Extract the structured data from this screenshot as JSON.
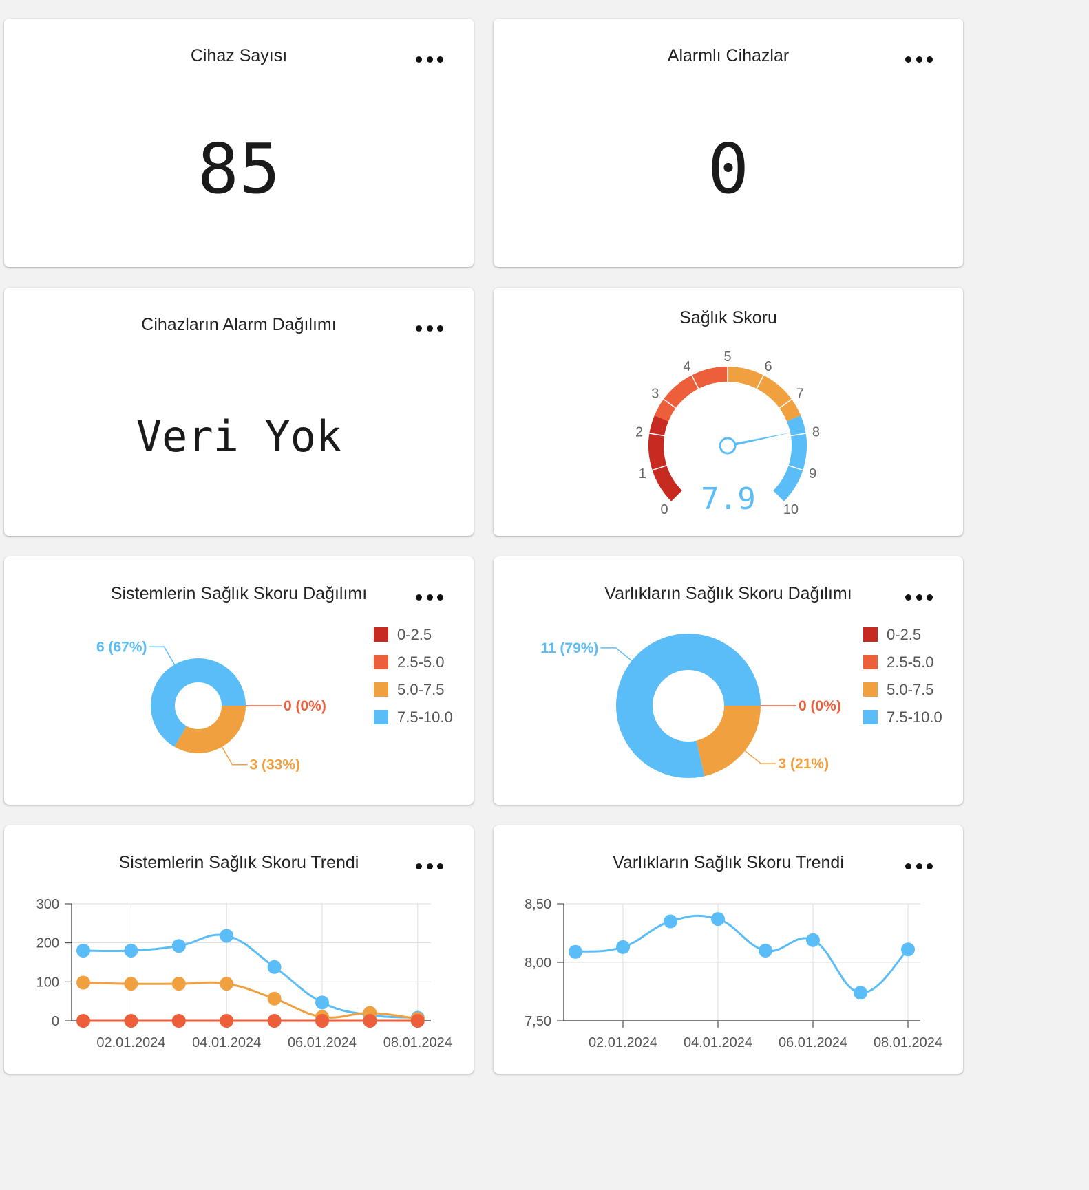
{
  "cards": {
    "device_count": {
      "title": "Cihaz Sayısı",
      "value": "85"
    },
    "alarmed_devices": {
      "title": "Alarmlı Cihazlar",
      "value": "0"
    },
    "alarm_distribution": {
      "title": "Cihazların Alarm Dağılımı",
      "value": "Veri Yok"
    },
    "health_score": {
      "title": "Sağlık Skoru",
      "value": "7.9",
      "gauge": {
        "min": 0,
        "max": 10,
        "value": 7.9,
        "ticks": [
          "0",
          "1",
          "2",
          "3",
          "4",
          "5",
          "6",
          "7",
          "8",
          "9",
          "10"
        ]
      }
    },
    "systems_distribution": {
      "title": "Sistemlerin Sağlık Skoru Dağılımı"
    },
    "assets_distribution": {
      "title": "Varlıkların Sağlık Skoru Dağılımı"
    },
    "systems_trend": {
      "title": "Sistemlerin Sağlık Skoru Trendi"
    },
    "assets_trend": {
      "title": "Varlıkların Sağlık Skoru Trendi"
    }
  },
  "colors": {
    "band_0_2_5": "#c62a21",
    "band_2_5_5_0": "#ec5f3a",
    "band_5_0_7_5": "#f0a03f",
    "band_7_5_10_0": "#5bbdf7"
  },
  "chart_data": [
    {
      "type": "pie",
      "title": "Sistemlerin Sağlık Skoru Dağılımı",
      "categories": [
        "0-2.5",
        "2.5-5.0",
        "5.0-7.5",
        "7.5-10.0"
      ],
      "values": [
        0,
        0,
        3,
        6
      ],
      "slice_labels": [
        {
          "text": "6 (67%)",
          "series": "7.5-10.0"
        },
        {
          "text": "0 (0%)",
          "series": "2.5-5.0"
        },
        {
          "text": "3 (33%)",
          "series": "5.0-7.5"
        }
      ],
      "legend": "right"
    },
    {
      "type": "pie",
      "title": "Varlıkların Sağlık Skoru Dağılımı",
      "categories": [
        "0-2.5",
        "2.5-5.0",
        "5.0-7.5",
        "7.5-10.0"
      ],
      "values": [
        0,
        0,
        3,
        11
      ],
      "slice_labels": [
        {
          "text": "11 (79%)",
          "series": "7.5-10.0"
        },
        {
          "text": "0 (0%)",
          "series": "2.5-5.0"
        },
        {
          "text": "3 (21%)",
          "series": "5.0-7.5"
        }
      ],
      "legend": "right"
    },
    {
      "type": "line",
      "title": "Sistemlerin Sağlık Skoru Trendi",
      "x": [
        "01.01.2024",
        "02.01.2024",
        "03.01.2024",
        "04.01.2024",
        "05.01.2024",
        "06.01.2024",
        "07.01.2024",
        "08.01.2024"
      ],
      "x_tick_labels": [
        "02.01.2024",
        "04.01.2024",
        "06.01.2024",
        "08.01.2024"
      ],
      "ylim": [
        0,
        300
      ],
      "y_ticks": [
        "0",
        "100",
        "200",
        "300"
      ],
      "grid": true,
      "series": [
        {
          "color": "#5bbdf7",
          "values": [
            180,
            180,
            192,
            218,
            138,
            47,
            15,
            8
          ]
        },
        {
          "color": "#f0a03f",
          "values": [
            98,
            95,
            95,
            95,
            57,
            10,
            20,
            5
          ]
        },
        {
          "color": "#ec5f3a",
          "values": [
            0,
            0,
            0,
            0,
            0,
            0,
            0,
            0
          ]
        }
      ]
    },
    {
      "type": "line",
      "title": "Varlıkların Sağlık Skoru Trendi",
      "x": [
        "01.01.2024",
        "02.01.2024",
        "03.01.2024",
        "04.01.2024",
        "05.01.2024",
        "06.01.2024",
        "07.01.2024",
        "08.01.2024"
      ],
      "x_tick_labels": [
        "02.01.2024",
        "04.01.2024",
        "06.01.2024",
        "08.01.2024"
      ],
      "ylim": [
        7.5,
        8.5
      ],
      "y_ticks": [
        "7,50",
        "8,00",
        "8,50"
      ],
      "grid": true,
      "series": [
        {
          "color": "#5bbdf7",
          "values": [
            8.09,
            8.13,
            8.35,
            8.37,
            8.1,
            8.19,
            7.74,
            8.11
          ]
        }
      ]
    }
  ]
}
